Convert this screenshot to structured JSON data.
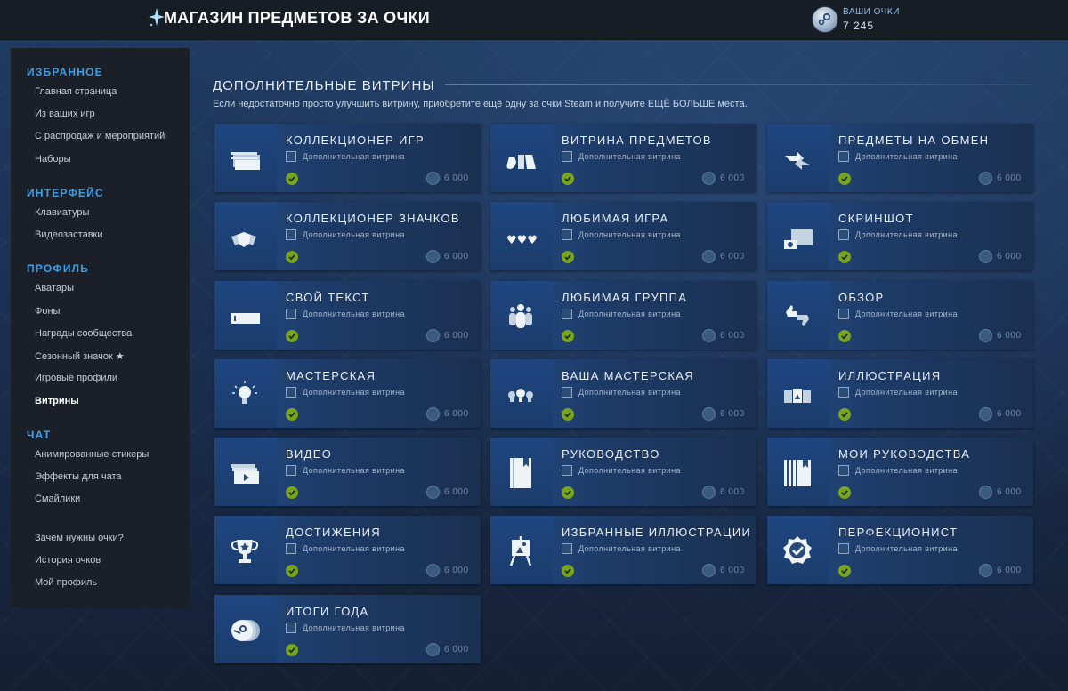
{
  "header": {
    "title": "МАГАЗИН ПРЕДМЕТОВ ЗА ОЧКИ",
    "points_label": "ВАШИ ОЧКИ",
    "points_value": "7 245"
  },
  "sidebar": {
    "sections": [
      {
        "title": "ИЗБРАННОЕ",
        "items": [
          "Главная страница",
          "Из ваших игр",
          "С распродаж и мероприятий",
          "Наборы"
        ]
      },
      {
        "title": "ИНТЕРФЕЙС",
        "items": [
          "Клавиатуры",
          "Видеозаставки"
        ]
      },
      {
        "title": "ПРОФИЛЬ",
        "items": [
          "Аватары",
          "Фоны",
          "Награды сообщества",
          "Сезонный значок ★",
          "Игровые профили",
          "Витрины"
        ]
      },
      {
        "title": "ЧАТ",
        "items": [
          "Анимированные стикеры",
          "Эффекты для чата",
          "Смайлики"
        ]
      }
    ],
    "footer_items": [
      "Зачем нужны очки?",
      "История очков",
      "Мой профиль"
    ],
    "active_item": "Витрины"
  },
  "content": {
    "title": "ДОПОЛНИТЕЛЬНЫЕ ВИТРИНЫ",
    "description": "Если недостаточно просто улучшить витрину, приобретите ещё одну за очки Steam и получите ЕЩЁ БОЛЬШЕ места."
  },
  "common": {
    "card_subtitle": "Дополнительная витрина",
    "card_price": "6 000"
  },
  "cards": [
    {
      "name": "КОЛЛЕКЦИОНЕР ИГР",
      "icon": "game-collector-icon"
    },
    {
      "name": "ВИТРИНА ПРЕДМЕТОВ",
      "icon": "items-showcase-icon"
    },
    {
      "name": "ПРЕДМЕТЫ НА ОБМЕН",
      "icon": "trade-icon"
    },
    {
      "name": "КОЛЛЕКЦИОНЕР ЗНАЧКОВ",
      "icon": "badge-collector-icon"
    },
    {
      "name": "ЛЮБИМАЯ ИГРА",
      "icon": "hearts-icon"
    },
    {
      "name": "СКРИНШОТ",
      "icon": "screenshot-icon"
    },
    {
      "name": "СВОЙ ТЕКСТ",
      "icon": "text-box-icon"
    },
    {
      "name": "ЛЮБИМАЯ ГРУППА",
      "icon": "group-icon"
    },
    {
      "name": "ОБЗОР",
      "icon": "review-thumbs-icon"
    },
    {
      "name": "МАСТЕРСКАЯ",
      "icon": "lightbulb-icon"
    },
    {
      "name": "ВАША МАСТЕРСКАЯ",
      "icon": "lightbulbs-icon"
    },
    {
      "name": "ИЛЛЮСТРАЦИЯ",
      "icon": "artwork-icon"
    },
    {
      "name": "ВИДЕО",
      "icon": "video-icon"
    },
    {
      "name": "РУКОВОДСТВО",
      "icon": "guide-book-icon"
    },
    {
      "name": "МОИ РУКОВОДСТВА",
      "icon": "guides-icon"
    },
    {
      "name": "ДОСТИЖЕНИЯ",
      "icon": "trophy-icon"
    },
    {
      "name": "ИЗБРАННЫЕ ИЛЛЮСТРАЦИИ",
      "icon": "easel-icon"
    },
    {
      "name": "ПЕРФЕКЦИОНИСТ",
      "icon": "perfectionist-icon"
    },
    {
      "name": "ИТОГИ ГОДА",
      "icon": "year-review-icon"
    }
  ],
  "colors": {
    "accent": "#3e9ee6",
    "check": "#77a51e",
    "header_bg": "#171d25",
    "sidebar_bg": "#1b2028"
  }
}
